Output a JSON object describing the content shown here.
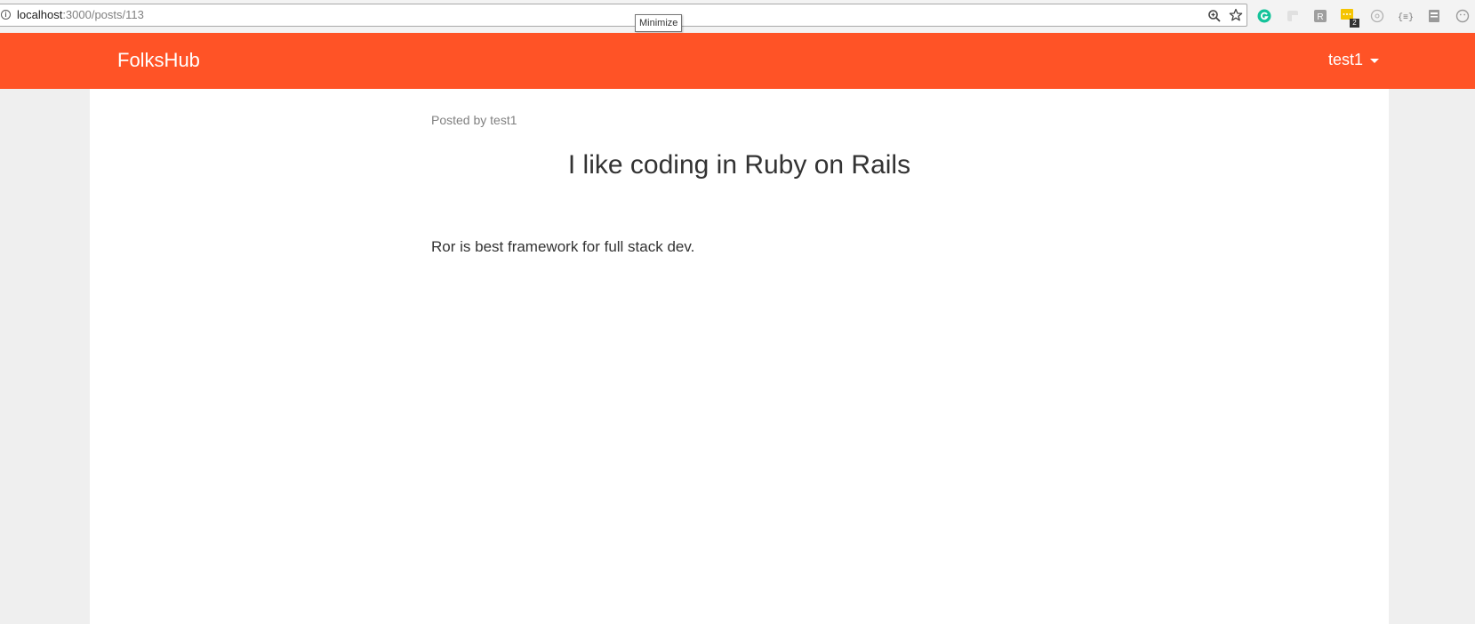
{
  "browser": {
    "url_host": "localhost",
    "url_path": ":3000/posts/113",
    "tooltip": "Minimize",
    "extension_badge": "2"
  },
  "navbar": {
    "brand": "FolksHub",
    "user": "test1",
    "color": "#ff5326"
  },
  "post": {
    "posted_by": "Posted by test1",
    "title": "I like coding in Ruby on Rails",
    "body": "Ror is best framework for full stack dev."
  }
}
